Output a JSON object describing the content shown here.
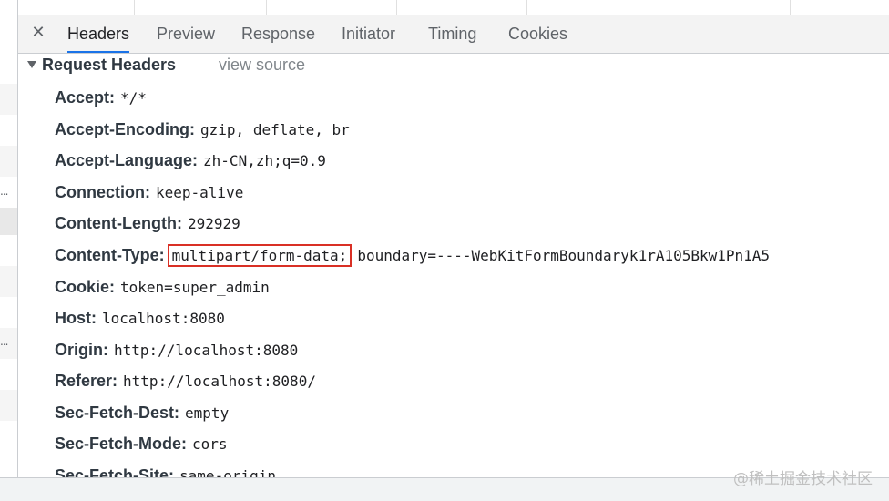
{
  "tabs": {
    "close_icon": "✕",
    "items": [
      {
        "label": "Headers"
      },
      {
        "label": "Preview"
      },
      {
        "label": "Response"
      },
      {
        "label": "Initiator"
      },
      {
        "label": "Timing"
      },
      {
        "label": "Cookies"
      }
    ],
    "active": "Headers"
  },
  "request_headers": {
    "title": "Request Headers",
    "view_source": "view source",
    "rows": [
      {
        "name": "Accept:",
        "value": "*/*"
      },
      {
        "name": "Accept-Encoding:",
        "value": "gzip, deflate, br"
      },
      {
        "name": "Accept-Language:",
        "value": "zh-CN,zh;q=0.9"
      },
      {
        "name": "Connection:",
        "value": "keep-alive"
      },
      {
        "name": "Content-Length:",
        "value": "292929"
      },
      {
        "name": "Content-Type:",
        "value_highlight": "multipart/form-data;",
        "value": "boundary=----WebKitFormBoundaryk1rA105Bkw1Pn1A5"
      },
      {
        "name": "Cookie:",
        "value": "token=super_admin"
      },
      {
        "name": "Host:",
        "value": "localhost:8080"
      },
      {
        "name": "Origin:",
        "value": "http://localhost:8080"
      },
      {
        "name": "Referer:",
        "value": "http://localhost:8080/"
      },
      {
        "name": "Sec-Fetch-Dest:",
        "value": "empty"
      },
      {
        "name": "Sec-Fetch-Mode:",
        "value": "cors"
      },
      {
        "name": "Sec-Fetch-Site:",
        "value": "same-origin"
      }
    ]
  },
  "left_panel": {
    "ellipsis": "..."
  },
  "watermark": "@稀土掘金技术社区",
  "colors": {
    "highlight_border": "#d93025",
    "active_tab_underline": "#1a73e8"
  }
}
